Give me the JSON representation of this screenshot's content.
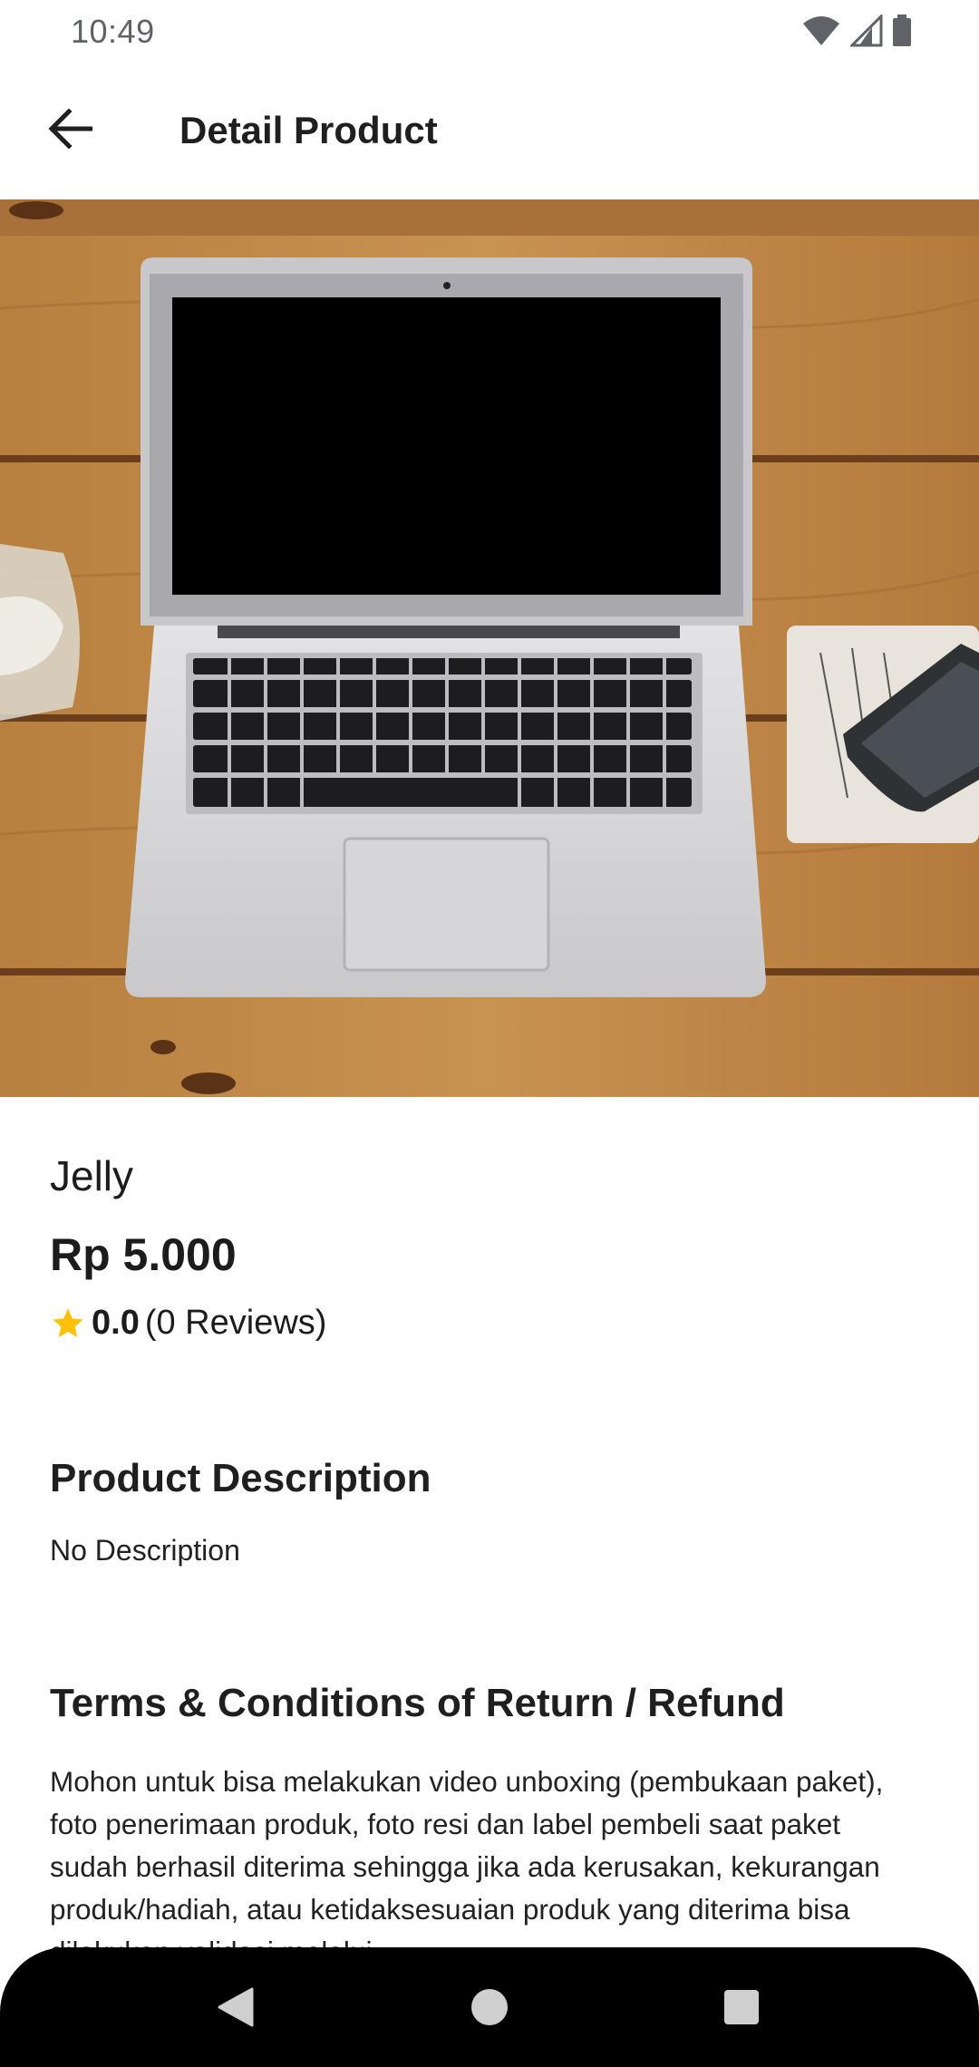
{
  "status_bar": {
    "time": "10:49",
    "icons": [
      "wifi-icon",
      "cell-signal-icon",
      "battery-icon"
    ]
  },
  "app_bar": {
    "back_icon": "arrow-back-icon",
    "title": "Detail Product"
  },
  "product": {
    "image_alt": "laptop-photo",
    "name": "Jelly",
    "price": "Rp 5.000",
    "rating": "0.0",
    "reviews": "(0 Reviews)"
  },
  "description": {
    "title": "Product Description",
    "text": "No Description"
  },
  "terms": {
    "title": "Terms & Conditions of Return / Refund",
    "text": "Mohon untuk bisa melakukan video unboxing (pembukaan paket), foto penerimaan produk, foto resi dan label pembeli saat paket sudah berhasil diterima sehingga jika ada kerusakan, kekurangan produk/hadiah, atau ketidaksesuaian produk yang diterima bisa dilakukan validasi melalui"
  },
  "nav_bar": {
    "buttons": [
      "back-triangle-icon",
      "home-circle-icon",
      "recents-square-icon"
    ]
  },
  "colors": {
    "star": "#FFC107",
    "nav_bg": "#000000",
    "text": "#1C1C1C"
  }
}
